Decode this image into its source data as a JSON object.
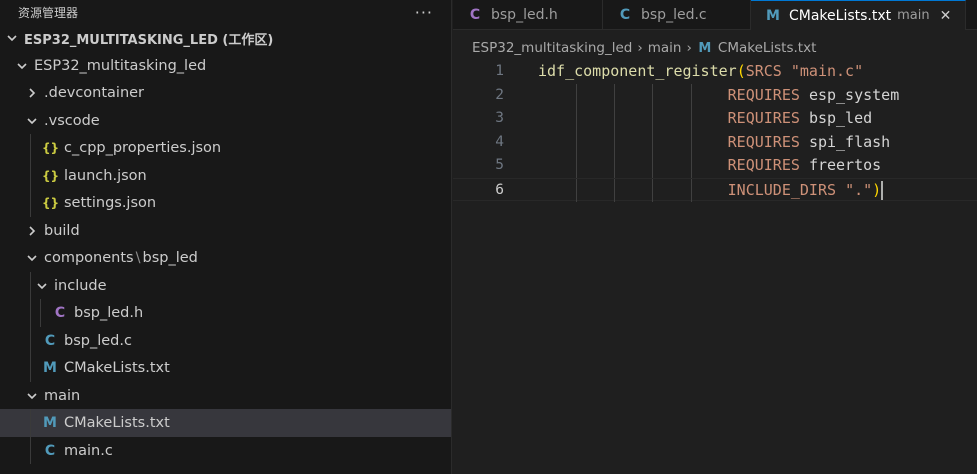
{
  "sidebar": {
    "title": "资源管理器",
    "more": "···",
    "rows": [
      {
        "label": "ESP32_MULTITASKING_LED (工作区)",
        "chevron": "down",
        "icon": "",
        "indent": 0,
        "workspace": true
      },
      {
        "label": "ESP32_multitasking_led",
        "chevron": "down",
        "icon": "",
        "indent": 1
      },
      {
        "label": ".devcontainer",
        "chevron": "right",
        "icon": "",
        "indent": 2
      },
      {
        "label": ".vscode",
        "chevron": "down",
        "icon": "",
        "indent": 2
      },
      {
        "label": "c_cpp_properties.json",
        "chevron": "",
        "icon": "json",
        "indent": 3
      },
      {
        "label": "launch.json",
        "chevron": "",
        "icon": "json",
        "indent": 3
      },
      {
        "label": "settings.json",
        "chevron": "",
        "icon": "json",
        "indent": 3
      },
      {
        "label": "build",
        "chevron": "right",
        "icon": "",
        "indent": 2
      },
      {
        "label": "components",
        "label2": "bsp_led",
        "chevron": "down",
        "icon": "",
        "indent": 2
      },
      {
        "label": "include",
        "chevron": "down",
        "icon": "",
        "indent": 3
      },
      {
        "label": "bsp_led.h",
        "chevron": "",
        "icon": "c",
        "indent": 4
      },
      {
        "label": "bsp_led.c",
        "chevron": "",
        "icon": "c2",
        "indent": 3
      },
      {
        "label": "CMakeLists.txt",
        "chevron": "",
        "icon": "m",
        "indent": 3
      },
      {
        "label": "main",
        "chevron": "down",
        "icon": "",
        "indent": 2
      },
      {
        "label": "CMakeLists.txt",
        "chevron": "",
        "icon": "m",
        "indent": 3,
        "selected": true
      },
      {
        "label": "main.c",
        "chevron": "",
        "icon": "c2",
        "indent": 3
      }
    ]
  },
  "icons": {
    "c_glyph": "C",
    "m_glyph": "M",
    "json_glyph": "{}"
  },
  "tabs": [
    {
      "label": "bsp_led.h",
      "icon": "c",
      "active": false
    },
    {
      "label": "bsp_led.c",
      "icon": "c2",
      "active": false
    },
    {
      "label": "CMakeLists.txt",
      "icon": "m",
      "active": true,
      "desc": "main",
      "close": "✕"
    }
  ],
  "breadcrumb": {
    "items": [
      "ESP32_multitasking_led",
      "main",
      "CMakeLists.txt"
    ],
    "separator": "›"
  },
  "code": {
    "active_line": 6,
    "lines": [
      {
        "num": "1",
        "parts": [
          {
            "t": "idf_component_register",
            "c": "fn"
          },
          {
            "t": "(",
            "c": "paren"
          },
          {
            "t": "SRCS ",
            "c": "req"
          },
          {
            "t": "\"main.c\"",
            "c": "str"
          }
        ]
      },
      {
        "num": "2",
        "parts": [
          {
            "t": "                     ",
            "c": "plain"
          },
          {
            "t": "REQUIRES ",
            "c": "req"
          },
          {
            "t": "esp_system",
            "c": "plain"
          }
        ]
      },
      {
        "num": "3",
        "parts": [
          {
            "t": "                     ",
            "c": "plain"
          },
          {
            "t": "REQUIRES ",
            "c": "req"
          },
          {
            "t": "bsp_led",
            "c": "plain"
          }
        ]
      },
      {
        "num": "4",
        "parts": [
          {
            "t": "                     ",
            "c": "plain"
          },
          {
            "t": "REQUIRES ",
            "c": "req"
          },
          {
            "t": "spi_flash",
            "c": "plain"
          }
        ]
      },
      {
        "num": "5",
        "parts": [
          {
            "t": "                     ",
            "c": "plain"
          },
          {
            "t": "REQUIRES ",
            "c": "req"
          },
          {
            "t": "freertos",
            "c": "plain"
          }
        ]
      },
      {
        "num": "6",
        "parts": [
          {
            "t": "                     ",
            "c": "plain"
          },
          {
            "t": "INCLUDE_DIRS ",
            "c": "req"
          },
          {
            "t": "\".\"",
            "c": "str"
          },
          {
            "t": ")",
            "c": "paren"
          }
        ]
      }
    ]
  },
  "colors": {
    "accent": "#0078d4",
    "selection": "#37373d",
    "function": "#dcdcaa",
    "string": "#ce9178"
  }
}
